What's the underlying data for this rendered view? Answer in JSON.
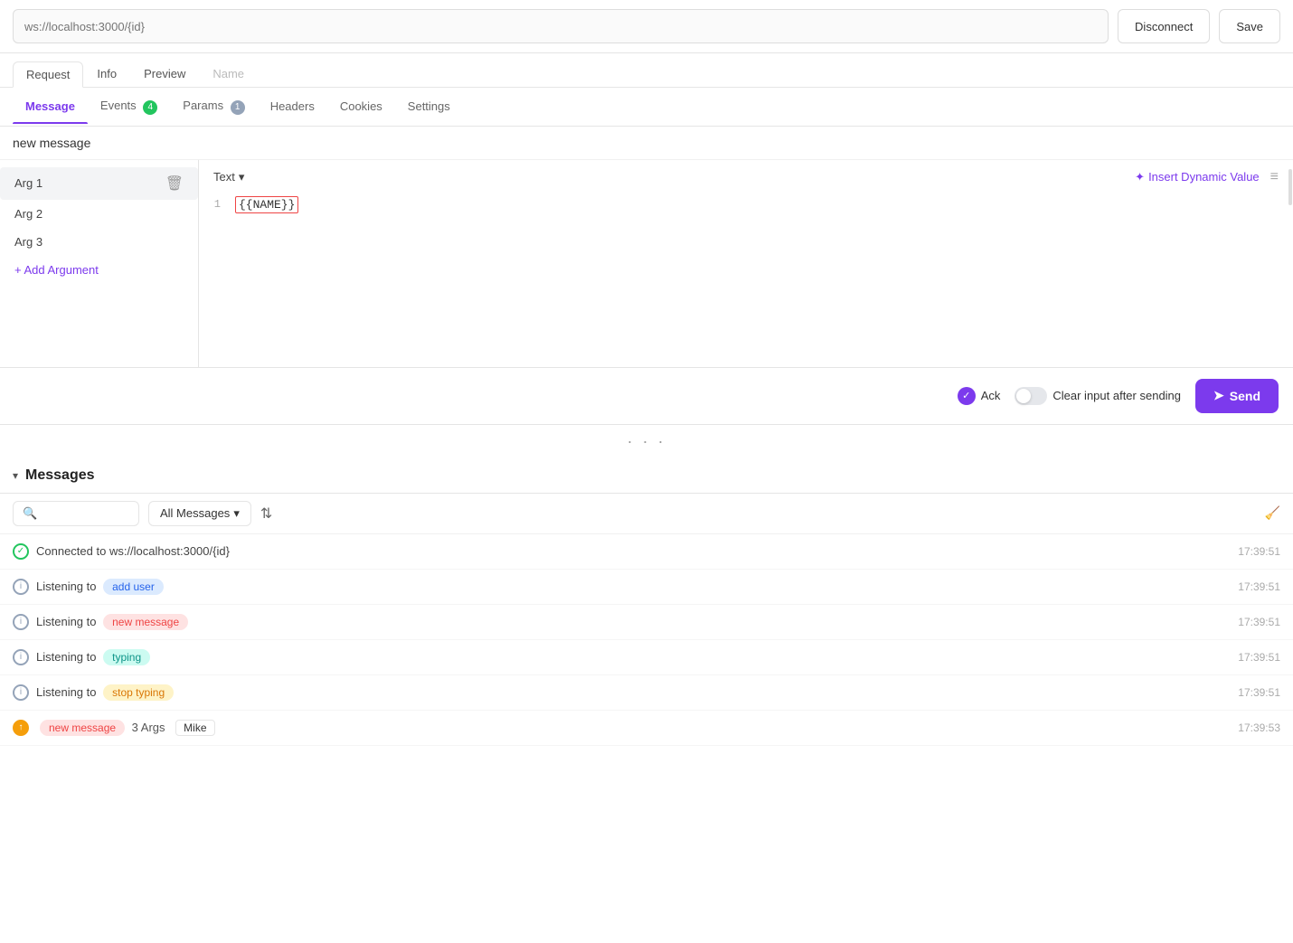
{
  "topbar": {
    "url_placeholder": "ws://localhost:3000/{id}",
    "disconnect_label": "Disconnect",
    "save_label": "Save"
  },
  "req_tabs": [
    {
      "id": "request",
      "label": "Request",
      "active": true
    },
    {
      "id": "info",
      "label": "Info",
      "active": false
    },
    {
      "id": "preview",
      "label": "Preview",
      "active": false
    },
    {
      "id": "name",
      "label": "Name",
      "active": false,
      "dim": true
    }
  ],
  "sub_tabs": [
    {
      "id": "message",
      "label": "Message",
      "active": true,
      "badge": null
    },
    {
      "id": "events",
      "label": "Events",
      "active": false,
      "badge": "4",
      "badge_color": "green"
    },
    {
      "id": "params",
      "label": "Params",
      "active": false,
      "badge": "1",
      "badge_color": "gray"
    },
    {
      "id": "headers",
      "label": "Headers",
      "active": false,
      "badge": null
    },
    {
      "id": "cookies",
      "label": "Cookies",
      "active": false,
      "badge": null
    },
    {
      "id": "settings",
      "label": "Settings",
      "active": false,
      "badge": null
    }
  ],
  "message_name": "new message",
  "args": [
    {
      "id": "arg1",
      "label": "Arg 1",
      "active": true
    },
    {
      "id": "arg2",
      "label": "Arg 2",
      "active": false
    },
    {
      "id": "arg3",
      "label": "Arg 3",
      "active": false
    }
  ],
  "add_argument_label": "+ Add Argument",
  "editor": {
    "type_label": "Text",
    "insert_dynamic_label": "Insert Dynamic Value",
    "line1_content": "{{NAME}}"
  },
  "bottom_bar": {
    "ack_label": "Ack",
    "clear_input_label": "Clear input after sending",
    "send_label": "Send"
  },
  "messages_section": {
    "title": "Messages",
    "filter_label": "All Messages",
    "search_placeholder": "",
    "messages": [
      {
        "type": "connected",
        "icon_type": "check",
        "text": "Connected to ws://localhost:3000/{id}",
        "time": "17:39:51"
      },
      {
        "type": "info",
        "icon_type": "i",
        "text": "Listening to",
        "badge_label": "add user",
        "badge_color": "blue",
        "time": "17:39:51"
      },
      {
        "type": "info",
        "icon_type": "i",
        "text": "Listening to",
        "badge_label": "new message",
        "badge_color": "red",
        "time": "17:39:51"
      },
      {
        "type": "info",
        "icon_type": "i",
        "text": "Listening to",
        "badge_label": "typing",
        "badge_color": "teal",
        "time": "17:39:51"
      },
      {
        "type": "info",
        "icon_type": "i",
        "text": "Listening to",
        "badge_label": "stop typing",
        "badge_color": "orange",
        "time": "17:39:51"
      },
      {
        "type": "sent",
        "icon_type": "arrow",
        "badge_label": "new message",
        "badge_color": "red",
        "args_label": "3 Args",
        "tag_value": "Mike",
        "time": "17:39:53"
      }
    ]
  }
}
